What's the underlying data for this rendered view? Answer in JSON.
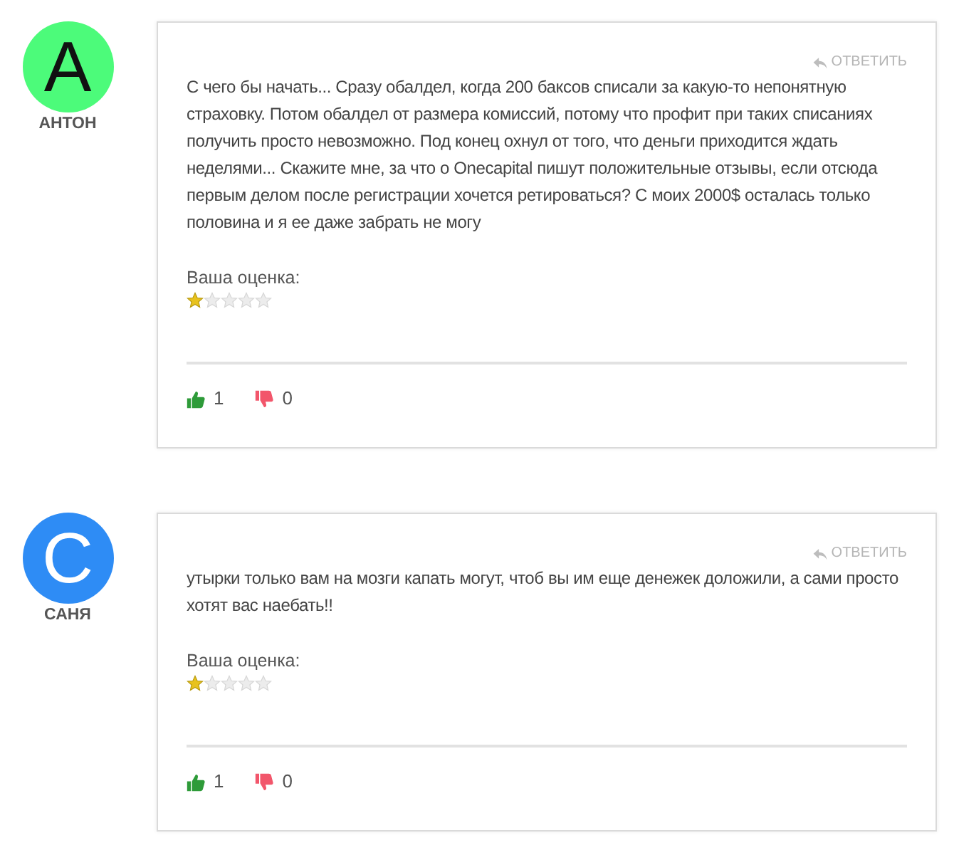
{
  "comments": [
    {
      "author": "АНТОН",
      "avatar": {
        "letter": "А",
        "color": "#4cfb7a"
      },
      "reply": "ОТВЕТИТЬ",
      "text": "С чего бы начать... Сразу обалдел, когда 200 баксов списали за какую-то непонятную страховку. Потом обалдел от размера комиссий, потому что профит при таких списаниях получить просто невозможно. Под конец охнул от того, что деньги приходится ждать неделями... Скажите мне, за что о Onecapital пишут положительные отзывы, если отсюда первым делом после регистрации хочется ретироваться? С моих 2000$ осталась только половина и я ее даже забрать не могу",
      "rating_label": "Ваша оценка:",
      "rating": {
        "stars": 1
      },
      "likes": "1",
      "dislikes": "0"
    },
    {
      "author": "САНЯ",
      "avatar": {
        "letter": "С",
        "color": "#2e8cf5"
      },
      "reply": "ОТВЕТИТЬ",
      "text": "утырки только вам на мозги капать могут, чтоб вы им еще денежек доложили, а сами просто хотят вас наебать!!",
      "rating_label": "Ваша оценка:",
      "rating": {
        "stars": 1
      },
      "likes": "1",
      "dislikes": "0"
    }
  ]
}
